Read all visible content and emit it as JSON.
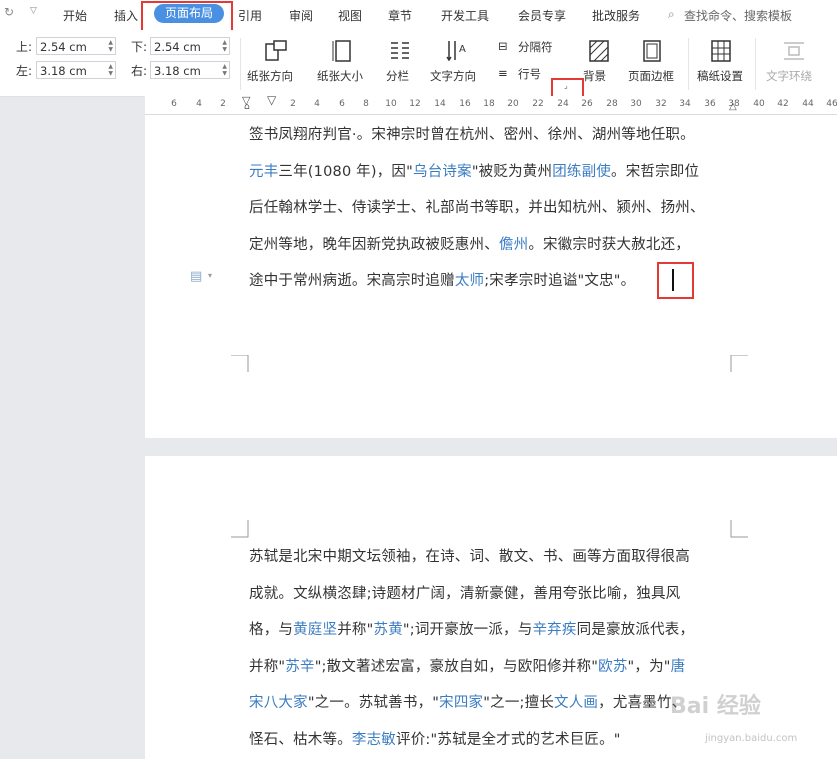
{
  "menubar": {
    "items": [
      "开始",
      "插入",
      "页面布局",
      "引用",
      "审阅",
      "视图",
      "章节",
      "开发工具",
      "会员专享",
      "批改服务"
    ],
    "active": "页面布局",
    "search_placeholder": "查找命令、搜索模板"
  },
  "margins": {
    "top_label": "上:",
    "top_value": "2.54 cm",
    "bottom_label": "下:",
    "bottom_value": "2.54 cm",
    "left_label": "左:",
    "left_value": "3.18 cm",
    "right_label": "右:",
    "right_value": "3.18 cm"
  },
  "tools": {
    "orientation": "纸张方向",
    "size": "纸张大小",
    "columns": "分栏",
    "text_direction": "文字方向",
    "breaks": "分隔符",
    "line_numbers": "行号",
    "background": "背景",
    "page_border": "页面边框",
    "manuscript": "稿纸设置",
    "text_wrap": "文字环绕"
  },
  "ruler": {
    "numbers": [
      "6",
      "4",
      "2",
      "",
      "2",
      "4",
      "6",
      "8",
      "10",
      "12",
      "14",
      "16",
      "18",
      "20",
      "22",
      "24",
      "26",
      "28",
      "30",
      "32",
      "34",
      "36",
      "38",
      "40",
      "42",
      "44",
      "46"
    ]
  },
  "page1": {
    "lines": [
      [
        {
          "t": "签书凤翔府判官·。宋神宗时曾在杭州、密州、徐州、湖州等地任职。"
        }
      ],
      [
        {
          "t": "元丰",
          "l": 1
        },
        {
          "t": "三年(1080 年)，因\""
        },
        {
          "t": "乌台诗案",
          "l": 1
        },
        {
          "t": "\"被贬为黄州"
        },
        {
          "t": "团练副使",
          "l": 1
        },
        {
          "t": "。宋哲宗即位"
        }
      ],
      [
        {
          "t": "后任翰林学士、侍读学士、礼部尚书等职，并出知杭州、颍州、扬州、"
        }
      ],
      [
        {
          "t": "定州等地，晚年因新党执政被贬惠州、"
        },
        {
          "t": "儋州",
          "l": 1
        },
        {
          "t": "。宋徽宗时获大赦北还，"
        }
      ],
      [
        {
          "t": "途中于常州病逝。宋高宗时追赠"
        },
        {
          "t": "太师",
          "l": 1
        },
        {
          "t": ";宋孝宗时追谥\"文忠\"。"
        }
      ]
    ]
  },
  "page2": {
    "lines": [
      [
        {
          "t": "苏轼是北宋中期文坛领袖，在诗、词、散文、书、画等方面取得很高"
        }
      ],
      [
        {
          "t": "成就。文纵横恣肆;诗题材广阔，清新豪健，善用夸张比喻，独具风"
        }
      ],
      [
        {
          "t": "格，与"
        },
        {
          "t": "黄庭坚",
          "l": 1
        },
        {
          "t": "并称\""
        },
        {
          "t": "苏黄",
          "l": 1
        },
        {
          "t": "\";词开豪放一派，与"
        },
        {
          "t": "辛弃疾",
          "l": 1
        },
        {
          "t": "同是豪放派代表，"
        }
      ],
      [
        {
          "t": "并称\""
        },
        {
          "t": "苏辛",
          "l": 1
        },
        {
          "t": "\";散文著述宏富，豪放自如，与欧阳修并称\""
        },
        {
          "t": "欧苏",
          "l": 1
        },
        {
          "t": "\"，为\""
        },
        {
          "t": "唐",
          "l": 1
        }
      ],
      [
        {
          "t": "宋八大家",
          "l": 1
        },
        {
          "t": "\"之一。苏轼善书，\""
        },
        {
          "t": "宋四家",
          "l": 1
        },
        {
          "t": "\"之一;擅长"
        },
        {
          "t": "文人画",
          "l": 1
        },
        {
          "t": "，尤喜墨竹、"
        }
      ],
      [
        {
          "t": "怪石、枯木等。"
        },
        {
          "t": "李志敏",
          "l": 1
        },
        {
          "t": "评价:\"苏轼是全才式的艺术巨匠。\""
        }
      ]
    ]
  },
  "watermark": {
    "text": "Bai 经验",
    "sub": "jingyan.baidu.com"
  },
  "colors": {
    "accent": "#4a90e2",
    "link": "#3b7dc3",
    "highlight": "#e53935"
  }
}
